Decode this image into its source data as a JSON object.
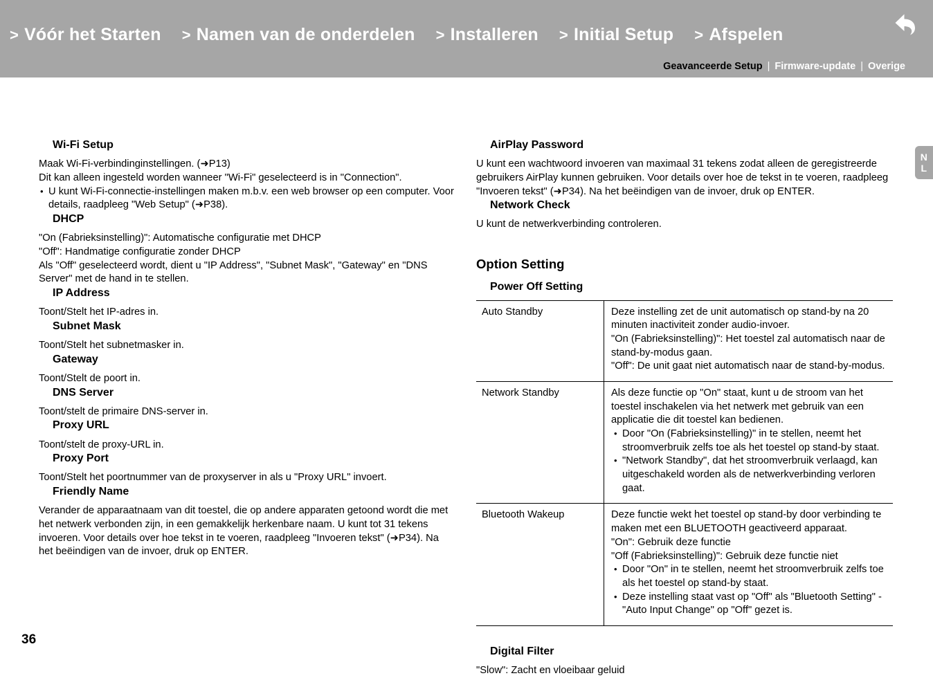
{
  "header": {
    "background_color": "#a6a6a6",
    "breadcrumb": [
      {
        "chevron": ">",
        "label": "Vóór het Starten"
      },
      {
        "chevron": ">",
        "label": "Namen van de onderdelen"
      },
      {
        "chevron": ">",
        "label": "Installeren"
      },
      {
        "chevron": ">",
        "label": "Initial Setup"
      },
      {
        "chevron": ">",
        "label": "Afspelen"
      }
    ],
    "subnav": {
      "items": [
        {
          "label": "Geavanceerde Setup",
          "active": true,
          "color": "#000000"
        },
        {
          "label": "Firmware-update",
          "active": false,
          "color": "#ffffff"
        },
        {
          "label": "Overige",
          "active": false,
          "color": "#ffffff"
        }
      ],
      "separator": "|"
    },
    "back_icon": "back-arrow-icon"
  },
  "language_tab": {
    "line1": "N",
    "line2": "L"
  },
  "left_column": {
    "wifi_setup": {
      "heading": "Wi-Fi Setup",
      "line1": "Maak Wi-Fi-verbindinginstellingen. (➜P13)",
      "line2": "Dit kan alleen ingesteld worden wanneer \"Wi-Fi\" geselecteerd is in \"Connection\".",
      "bullet1": "U kunt Wi-Fi-connectie-instellingen maken m.b.v. een web browser op een computer. Voor details, raadpleeg \"Web Setup\" (➜P38)."
    },
    "dhcp": {
      "heading": "DHCP",
      "line1": "\"On (Fabrieksinstelling)\": Automatische configuratie met DHCP",
      "line2": "\"Off\": Handmatige configuratie zonder DHCP",
      "line3": "Als \"Off\" geselecteerd wordt, dient u \"IP Address\", \"Subnet Mask\", \"Gateway\" en \"DNS Server\" met de hand in te stellen."
    },
    "ip_address": {
      "heading": "IP Address",
      "body": "Toont/Stelt het IP-adres in."
    },
    "subnet_mask": {
      "heading": "Subnet Mask",
      "body": "Toont/Stelt het subnetmasker in."
    },
    "gateway": {
      "heading": "Gateway",
      "body": "Toont/Stelt de poort in."
    },
    "dns_server": {
      "heading": "DNS Server",
      "body": "Toont/stelt de primaire DNS-server in."
    },
    "proxy_url": {
      "heading": "Proxy URL",
      "body": "Toont/stelt de proxy-URL in."
    },
    "proxy_port": {
      "heading": "Proxy Port",
      "body": "Toont/Stelt het poortnummer van de proxyserver in als u \"Proxy URL\" invoert."
    },
    "friendly_name": {
      "heading": "Friendly Name",
      "body": "Verander de apparaatnaam van dit toestel, die op andere apparaten getoond wordt die met het netwerk verbonden zijn, in een gemakkelijk herkenbare naam. U kunt tot 31 tekens invoeren. Voor details over hoe tekst in te voeren, raadpleeg \"Invoeren tekst\" (➜P34). Na het beëindigen van de invoer, druk op ENTER."
    }
  },
  "right_column": {
    "airplay_password": {
      "heading": "AirPlay Password",
      "body": "U kunt een wachtwoord invoeren van maximaal 31 tekens zodat alleen de geregistreerde gebruikers AirPlay kunnen gebruiken. Voor details over hoe de tekst in te voeren, raadpleeg \"Invoeren tekst\" (➜P34). Na het beëindigen van de invoer, druk op ENTER."
    },
    "network_check": {
      "heading": "Network Check",
      "body": "U kunt de netwerkverbinding controleren."
    },
    "option_setting": {
      "heading": "Option Setting"
    },
    "power_off_setting": {
      "heading": "Power Off Setting"
    },
    "power_off_table": {
      "rows": [
        {
          "key": "Auto Standby",
          "lines": [
            "Deze instelling zet de unit automatisch op stand-by na 20 minuten inactiviteit zonder audio-invoer.",
            "\"On (Fabrieksinstelling)\": Het toestel zal automatisch naar de stand-by-modus gaan.",
            "\"Off\": De unit gaat niet automatisch naar de stand-by-modus."
          ],
          "bullets": []
        },
        {
          "key": "Network Standby",
          "lines": [
            "Als deze functie op \"On\" staat, kunt u de stroom van het toestel inschakelen via het netwerk met gebruik van een applicatie die dit toestel kan bedienen."
          ],
          "bullets": [
            "Door \"On (Fabrieksinstelling)\" in te stellen, neemt het stroomverbruik zelfs toe als het toestel op stand-by staat.",
            "\"Network Standby\", dat het stroomverbruik verlaagd, kan uitgeschakeld worden als de netwerkverbinding verloren gaat."
          ]
        },
        {
          "key": "Bluetooth Wakeup",
          "lines": [
            "Deze functie wekt het toestel op stand-by door verbinding te maken met een BLUETOOTH geactiveerd apparaat.",
            "\"On\": Gebruik deze functie",
            "\"Off (Fabrieksinstelling)\": Gebruik deze functie niet"
          ],
          "bullets": [
            "Door \"On\" in te stellen, neemt het stroomverbruik zelfs toe als het toestel op stand-by staat.",
            "Deze instelling staat vast op \"Off\" als \"Bluetooth Setting\" - \"Auto Input Change\" op \"Off\" gezet is."
          ]
        }
      ]
    },
    "digital_filter": {
      "heading": "Digital Filter",
      "body": "\"Slow\": Zacht en vloeibaar geluid"
    }
  },
  "footer": {
    "page_number": "36"
  }
}
